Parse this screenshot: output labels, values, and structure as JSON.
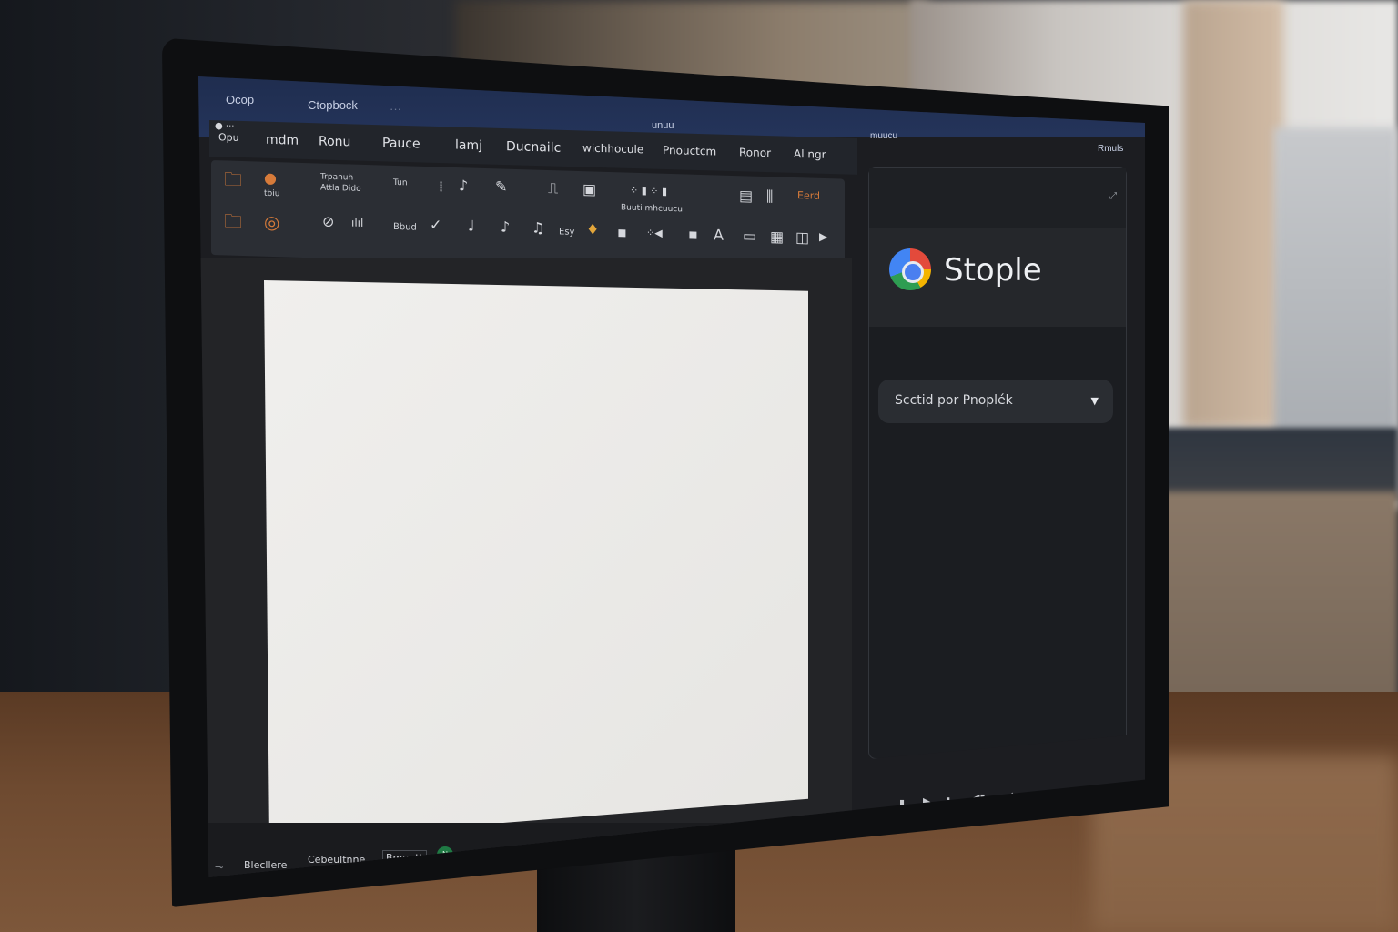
{
  "titlebar": {
    "left_label": "Ocop",
    "tab_label": "Ctopbock",
    "center_label": "unuu",
    "mid_right_label": "muucu",
    "right_label": "Rmuls"
  },
  "menu": {
    "items": [
      "Opu",
      "mdm",
      "Ronu",
      "Pauce",
      "lamj",
      "Ducnailc",
      "wichhocule",
      "Pnouctcm",
      "Ronor",
      "Al ngr"
    ]
  },
  "ribbon": {
    "label_1": "Trpanuh",
    "label_2": "Attla Dido",
    "label_3": "Tun",
    "label_4": "Buuti mhcuucu",
    "label_5": "tbiu",
    "label_6": "Bbud",
    "label_7": "Esy",
    "label_8": "Eerd"
  },
  "panel": {
    "brand_name": "Stople",
    "select_value": "Scctid por Pnoplék"
  },
  "statusbar": {
    "item_1": "Blecllere",
    "item_2": "Cebeultnne",
    "item_3": "Bmuntt",
    "badge": "N"
  },
  "colors": {
    "titlebar": "#24345a",
    "accent_orange": "#d77b3a",
    "badge_green": "#1f7a44"
  }
}
